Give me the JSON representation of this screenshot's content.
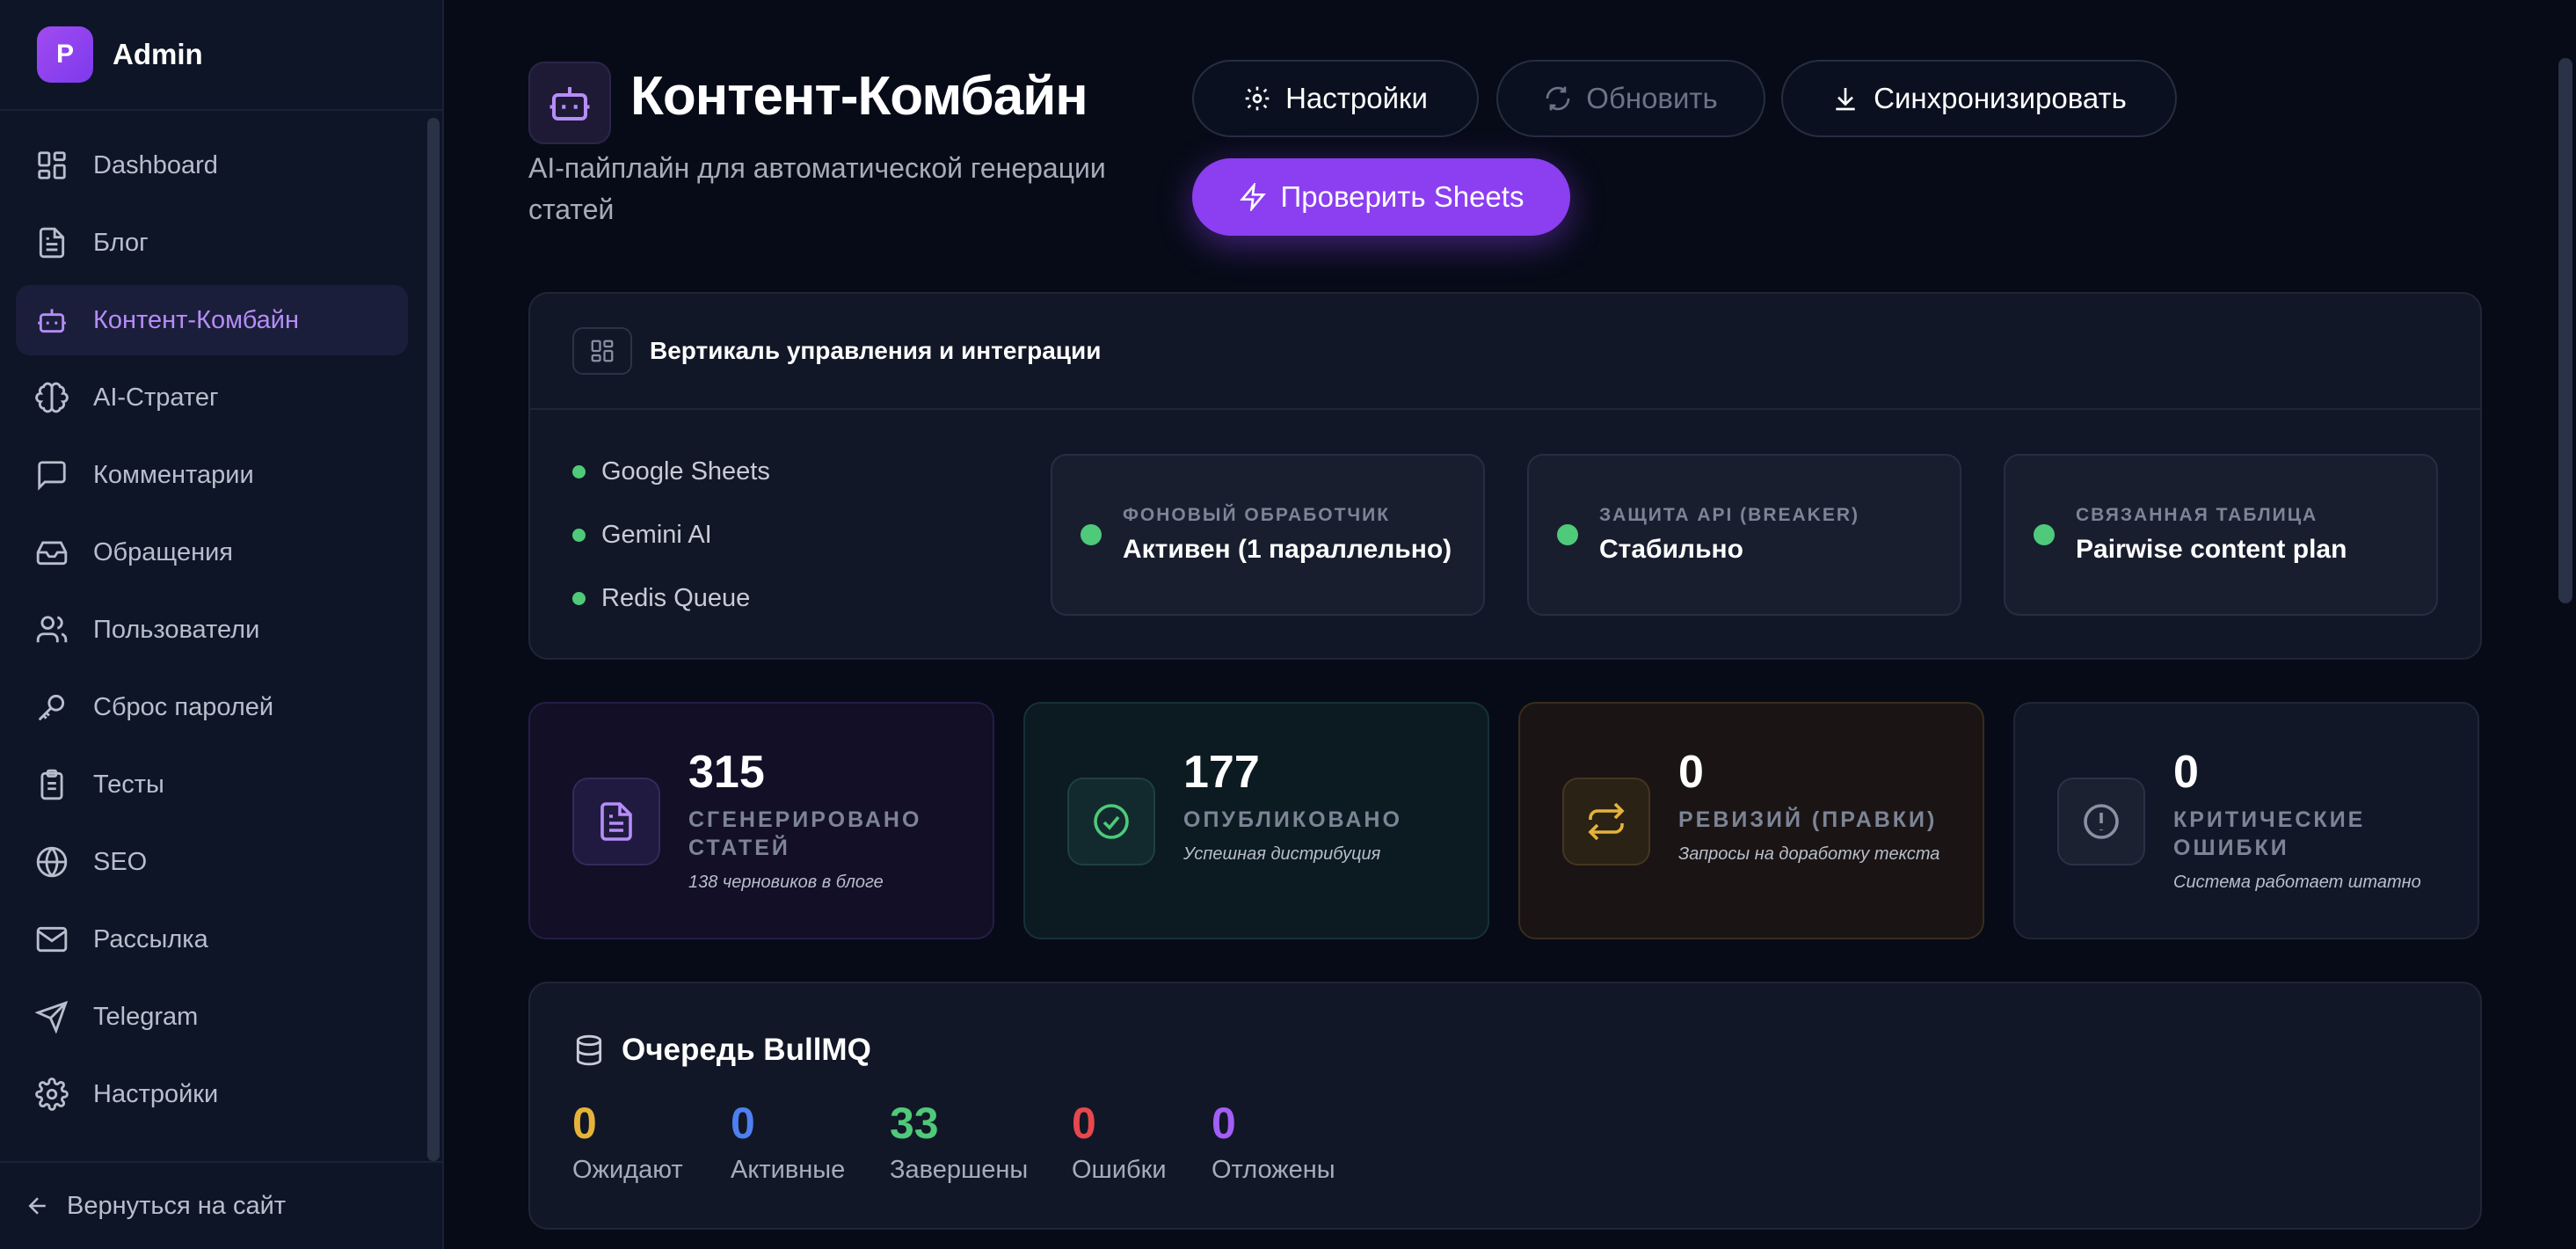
{
  "sidebar": {
    "brand_initial": "P",
    "brand_name": "Admin",
    "items": [
      {
        "label": "Dashboard",
        "icon": "grid-icon",
        "active": false
      },
      {
        "label": "Блог",
        "icon": "document-icon",
        "active": false
      },
      {
        "label": "Контент-Комбайн",
        "icon": "robot-icon",
        "active": true
      },
      {
        "label": "AI-Стратег",
        "icon": "brain-icon",
        "active": false
      },
      {
        "label": "Комментарии",
        "icon": "message-icon",
        "active": false
      },
      {
        "label": "Обращения",
        "icon": "inbox-icon",
        "active": false
      },
      {
        "label": "Пользователи",
        "icon": "users-icon",
        "active": false
      },
      {
        "label": "Сброс паролей",
        "icon": "key-icon",
        "active": false
      },
      {
        "label": "Тесты",
        "icon": "clipboard-icon",
        "active": false
      },
      {
        "label": "SEO",
        "icon": "globe-icon",
        "active": false
      },
      {
        "label": "Рассылка",
        "icon": "mail-icon",
        "active": false
      },
      {
        "label": "Telegram",
        "icon": "send-icon",
        "active": false
      },
      {
        "label": "Настройки",
        "icon": "gear-icon",
        "active": false
      }
    ],
    "footer_label": "Вернуться на сайт"
  },
  "header": {
    "title": "Контент-Комбайн",
    "subtitle": "AI-пайплайн для автоматической генерации статей",
    "buttons": {
      "settings": "Настройки",
      "refresh": "Обновить",
      "sync": "Синхронизировать",
      "check_sheets": "Проверить Sheets"
    }
  },
  "integrations": {
    "title": "Вертикаль управления и интеграции",
    "services": [
      "Google Sheets",
      "Gemini AI",
      "Redis Queue"
    ],
    "statuses": [
      {
        "label": "ФОНОВЫЙ ОБРАБОТЧИК",
        "value": "Активен (1 параллельно)"
      },
      {
        "label": "ЗАЩИТА API (BREAKER)",
        "value": "Стабильно"
      },
      {
        "label": "СВЯЗАННАЯ ТАБЛИЦА",
        "value": "Pairwise content plan"
      }
    ]
  },
  "stats": [
    {
      "value": "315",
      "label": "СГЕНЕРИРОВАНО СТАТЕЙ",
      "sub": "138 черновиков в блоге",
      "icon": "document-icon"
    },
    {
      "value": "177",
      "label": "ОПУБЛИКОВАНО",
      "sub": "Успешная дистрибуция",
      "icon": "check-circle-icon"
    },
    {
      "value": "0",
      "label": "РЕВИЗИЙ (ПРАВКИ)",
      "sub": "Запросы на доработку текста",
      "icon": "swap-icon"
    },
    {
      "value": "0",
      "label": "КРИТИЧЕСКИЕ ОШИБКИ",
      "sub": "Система работает штатно",
      "icon": "alert-circle-icon"
    }
  ],
  "queue": {
    "title": "Очередь BullMQ",
    "items": [
      {
        "value": "0",
        "label": "Ожидают",
        "color": "#e6b23a"
      },
      {
        "value": "0",
        "label": "Активные",
        "color": "#4f7ff0"
      },
      {
        "value": "33",
        "label": "Завершены",
        "color": "#4fc97a"
      },
      {
        "value": "0",
        "label": "Ошибки",
        "color": "#e5484d"
      },
      {
        "value": "0",
        "label": "Отложены",
        "color": "#a25ef5"
      }
    ]
  },
  "colors": {
    "accent": "#8b3ff0",
    "status_ok": "#4fc97a"
  }
}
